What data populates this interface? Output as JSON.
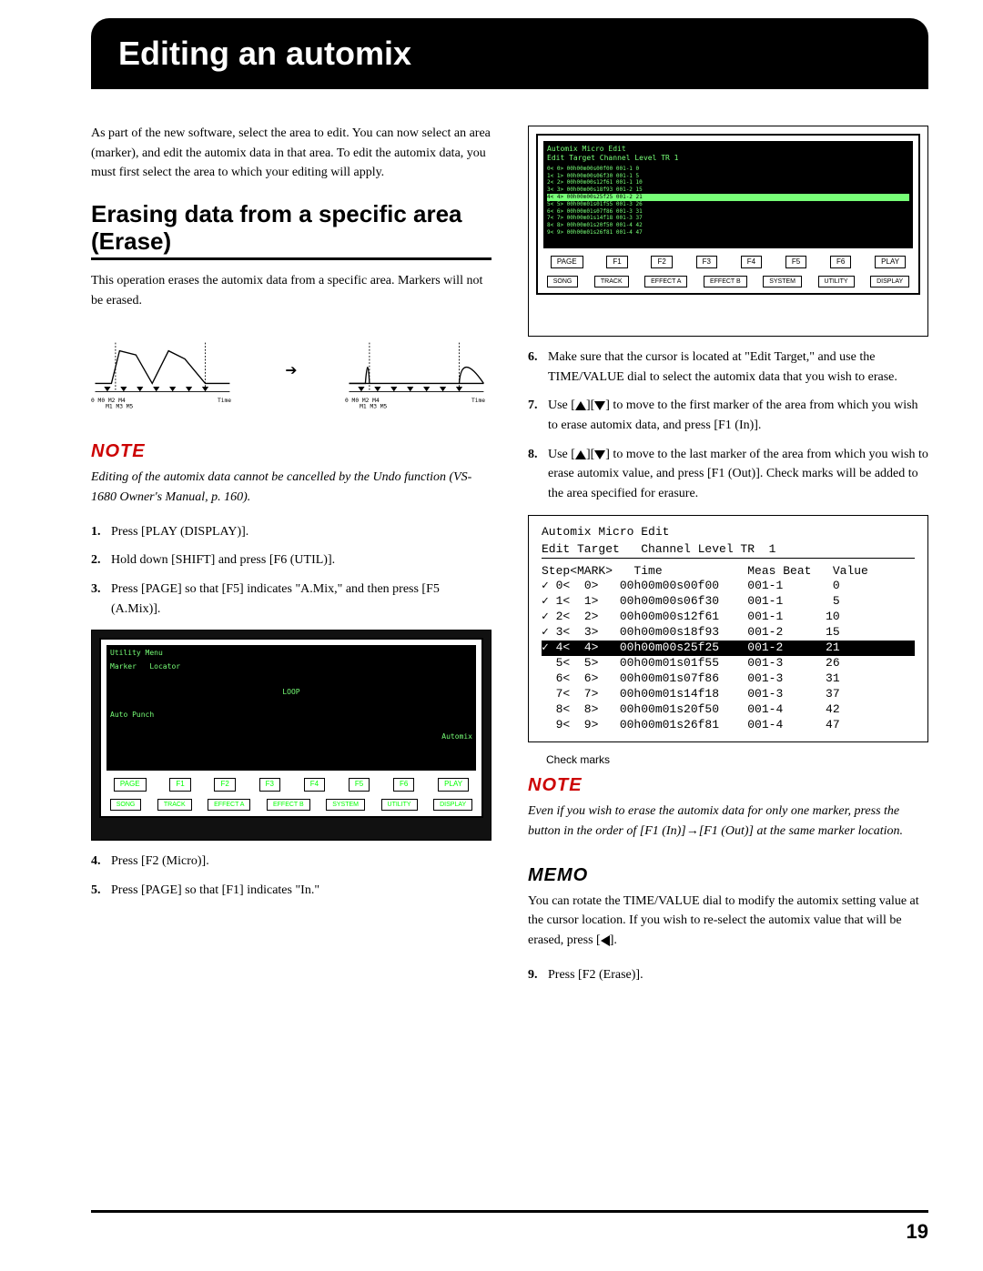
{
  "title": "Editing an automix",
  "intro": "As part of the new software, select the area to edit. You can now select an area (marker), and edit the automix data in that area. To edit the automix data, you must first select the area to which your editing will apply.",
  "section1": {
    "heading": "Erasing data from a specific area (Erase)",
    "para1": "This operation erases the automix data from a specific area. Markers will not be erased.",
    "graph_labels": {
      "left": "0  M0  M2   M4",
      "left2": "M1  M3   M5",
      "time": "Time"
    },
    "note_label": "NOTE",
    "note1": "Editing of the automix data cannot be cancelled by the Undo function (VS-1680 Owner's Manual, p. 160).",
    "steps_a": [
      {
        "n": "1.",
        "t": "Press [PLAY (DISPLAY)]."
      },
      {
        "n": "2.",
        "t": "Hold down [SHIFT] and press [F6 (UTIL)]."
      },
      {
        "n": "3.",
        "t": "Press [PAGE] so that [F5] indicates \"A.Mix,\" and then press [F5 (A.Mix)]."
      }
    ],
    "steps_b": [
      {
        "n": "4.",
        "t": "Press [F2 (Micro)]."
      },
      {
        "n": "5.",
        "t": "Press [PAGE] so that [F1] indicates \"In.\""
      }
    ],
    "screen1_labels": {
      "utility": "Utility Menu",
      "marker": "Marker",
      "locator": "Locator",
      "loop": "LOOP",
      "autopunch": "Auto Punch",
      "automix": "Automix"
    }
  },
  "right": {
    "steps": [
      {
        "n": "6.",
        "t": "Make sure that the cursor is located at \"Edit Target,\" and use the TIME/VALUE dial to select the automix data that you wish to erase."
      },
      {
        "n": "7.",
        "pre": "Use [",
        "mid": "][",
        "post": "] to move to the first marker of the area from which you wish to erase automix data, and press [F1 (In)]."
      },
      {
        "n": "8.",
        "pre": "Use [",
        "mid": "][",
        "post": "] to move to the last marker of the area from which you wish to erase automix value, and press [F1 (Out)]. Check marks will be added to the area specified for erasure."
      }
    ],
    "device_labels": {
      "page": "PAGE",
      "f1": "F1",
      "f2": "F2",
      "f3": "F3",
      "f4": "F4",
      "f5": "F5",
      "f6": "F6",
      "play": "PLAY",
      "song": "SONG",
      "track": "TRACK",
      "effecta": "EFFECT A",
      "effectb": "EFFECT B",
      "system": "SYSTEM",
      "utility": "UTILITY",
      "display": "DISPLAY"
    },
    "screen3": {
      "title": "Automix Micro Edit",
      "line2": "Edit Target   Channel Level TR  1",
      "header": "Step<MARK>   Time            Meas Beat   Value",
      "rows": [
        {
          "chk": "✓",
          "l": "0<",
          "r": "0>",
          "time": "00h00m00s00f00",
          "mb": "001-1",
          "v": "0"
        },
        {
          "chk": "✓",
          "l": "1<",
          "r": "1>",
          "time": "00h00m00s06f30",
          "mb": "001-1",
          "v": "5"
        },
        {
          "chk": "✓",
          "l": "2<",
          "r": "2>",
          "time": "00h00m00s12f61",
          "mb": "001-1",
          "v": "10"
        },
        {
          "chk": "✓",
          "l": "3<",
          "r": "3>",
          "time": "00h00m00s18f93",
          "mb": "001-2",
          "v": "15"
        },
        {
          "chk": "✓",
          "l": "4<",
          "r": "4>",
          "time": "00h00m00s25f25",
          "mb": "001-2",
          "v": "21",
          "hl": true
        },
        {
          "chk": "",
          "l": "5<",
          "r": "5>",
          "time": "00h00m01s01f55",
          "mb": "001-3",
          "v": "26"
        },
        {
          "chk": "",
          "l": "6<",
          "r": "6>",
          "time": "00h00m01s07f86",
          "mb": "001-3",
          "v": "31"
        },
        {
          "chk": "",
          "l": "7<",
          "r": "7>",
          "time": "00h00m01s14f18",
          "mb": "001-3",
          "v": "37"
        },
        {
          "chk": "",
          "l": "8<",
          "r": "8>",
          "time": "00h00m01s20f50",
          "mb": "001-4",
          "v": "42"
        },
        {
          "chk": "",
          "l": "9<",
          "r": "9>",
          "time": "00h00m01s26f81",
          "mb": "001-4",
          "v": "47"
        }
      ]
    },
    "caption": "Check marks",
    "note_label": "NOTE",
    "note2": "Even if you wish to erase the automix data for only one marker, press the button in the order of [F1 (In)]→[F1 (Out)] at the same marker location.",
    "memo_label": "MEMO",
    "memo_pre": "You can rotate the TIME/VALUE dial to modify the automix setting value at the cursor location. If you wish to re-select the automix value that will be erased, press [",
    "memo_post": "].",
    "step9": {
      "n": "9.",
      "t": "Press [F2 (Erase)]."
    }
  },
  "page_number": "19"
}
